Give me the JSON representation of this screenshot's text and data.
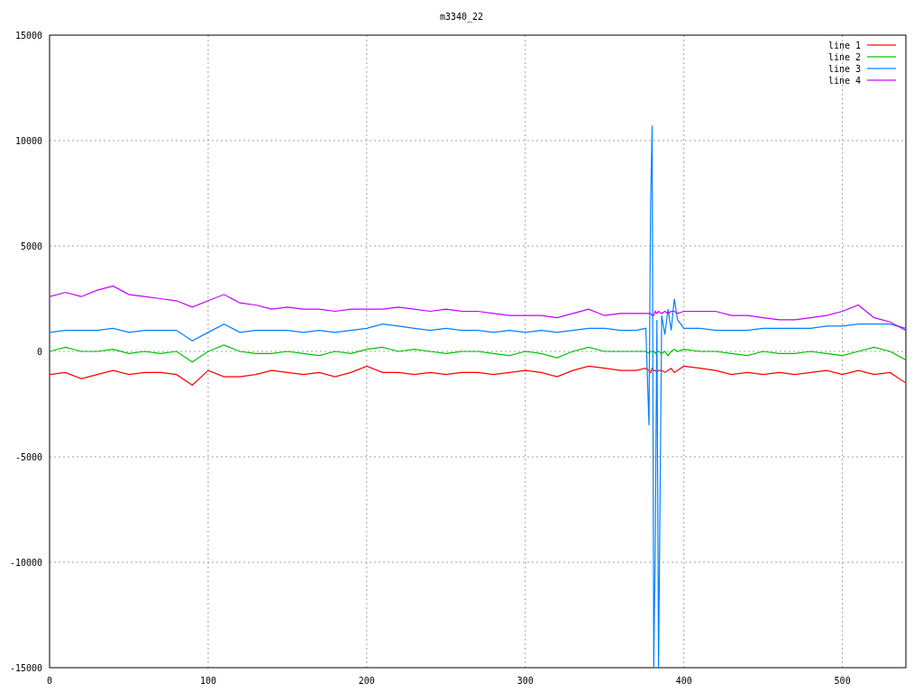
{
  "chart_data": {
    "type": "line",
    "title": "m3340_22",
    "x": [
      0,
      10,
      20,
      30,
      40,
      50,
      60,
      70,
      80,
      90,
      100,
      110,
      120,
      130,
      140,
      150,
      160,
      170,
      180,
      190,
      200,
      210,
      220,
      230,
      240,
      250,
      260,
      270,
      280,
      290,
      300,
      310,
      320,
      330,
      340,
      350,
      360,
      370,
      376,
      378,
      379,
      380,
      381,
      382,
      383,
      384,
      386,
      388,
      390,
      392,
      394,
      396,
      400,
      410,
      420,
      430,
      440,
      450,
      460,
      470,
      480,
      490,
      500,
      510,
      520,
      530,
      540
    ],
    "series": [
      {
        "name": "line 1",
        "color": "#ff0000",
        "values": [
          -1100,
          -1000,
          -1300,
          -1100,
          -900,
          -1100,
          -1000,
          -1000,
          -1100,
          -1600,
          -900,
          -1200,
          -1200,
          -1100,
          -900,
          -1000,
          -1100,
          -1000,
          -1200,
          -1000,
          -700,
          -1000,
          -1000,
          -1100,
          -1000,
          -1100,
          -1000,
          -1000,
          -1100,
          -1000,
          -900,
          -1000,
          -1200,
          -900,
          -700,
          -800,
          -900,
          -900,
          -800,
          -900,
          -1000,
          -800,
          -900,
          -900,
          -1000,
          -900,
          -900,
          -1000,
          -900,
          -800,
          -1000,
          -900,
          -700,
          -800,
          -900,
          -1100,
          -1000,
          -1100,
          -1000,
          -1100,
          -1000,
          -900,
          -1100,
          -900,
          -1100,
          -1000,
          -1500
        ]
      },
      {
        "name": "line 2",
        "color": "#00c000",
        "values": [
          0,
          200,
          0,
          0,
          100,
          -100,
          0,
          -100,
          0,
          -500,
          0,
          300,
          0,
          -100,
          -100,
          0,
          -100,
          -200,
          0,
          -100,
          100,
          200,
          0,
          100,
          0,
          -100,
          0,
          0,
          -100,
          -200,
          0,
          -100,
          -300,
          0,
          200,
          0,
          0,
          0,
          0,
          -100,
          0,
          0,
          0,
          -100,
          0,
          0,
          -100,
          0,
          -200,
          0,
          100,
          0,
          100,
          0,
          0,
          -100,
          -200,
          0,
          -100,
          -100,
          0,
          -100,
          -200,
          0,
          200,
          0,
          -400
        ]
      },
      {
        "name": "line 3",
        "color": "#0080ff",
        "values": [
          900,
          1000,
          1000,
          1000,
          1100,
          900,
          1000,
          1000,
          1000,
          500,
          900,
          1300,
          900,
          1000,
          1000,
          1000,
          900,
          1000,
          900,
          1000,
          1100,
          1300,
          1200,
          1100,
          1000,
          1100,
          1000,
          1000,
          900,
          1000,
          900,
          1000,
          900,
          1000,
          1100,
          1100,
          1000,
          1000,
          1100,
          -3500,
          7000,
          10700,
          -15000,
          -9000,
          1500,
          -15000,
          1700,
          800,
          2000,
          1000,
          2500,
          1500,
          1100,
          1100,
          1000,
          1000,
          1000,
          1100,
          1100,
          1100,
          1100,
          1200,
          1200,
          1300,
          1300,
          1300,
          1100
        ]
      },
      {
        "name": "line 4",
        "color": "#c000ff",
        "values": [
          2600,
          2800,
          2600,
          2900,
          3100,
          2700,
          2600,
          2500,
          2400,
          2100,
          2400,
          2700,
          2300,
          2200,
          2000,
          2100,
          2000,
          2000,
          1900,
          2000,
          2000,
          2000,
          2100,
          2000,
          1900,
          2000,
          1900,
          1900,
          1800,
          1700,
          1700,
          1700,
          1600,
          1800,
          2000,
          1700,
          1800,
          1800,
          1800,
          1800,
          1800,
          1700,
          1700,
          1900,
          1800,
          1900,
          1800,
          1900,
          1800,
          1900,
          1900,
          1800,
          1900,
          1900,
          1900,
          1700,
          1700,
          1600,
          1500,
          1500,
          1600,
          1700,
          1900,
          2200,
          1600,
          1400,
          1000
        ]
      }
    ],
    "xlim": [
      0,
      540
    ],
    "ylim": [
      -15000,
      15000
    ],
    "xticks": [
      0,
      100,
      200,
      300,
      400,
      500
    ],
    "yticks": [
      -15000,
      -10000,
      -5000,
      0,
      5000,
      10000,
      15000
    ],
    "grid": true,
    "legend": true
  }
}
